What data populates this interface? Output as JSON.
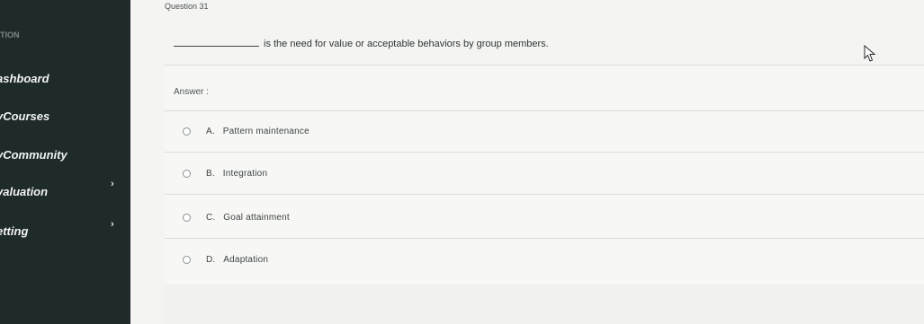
{
  "sidebar": {
    "brand": "TION",
    "items": [
      {
        "label": "ashboard",
        "has_chevron": false
      },
      {
        "label": "yCourses",
        "has_chevron": false
      },
      {
        "label": "yCommunity",
        "has_chevron": false
      },
      {
        "label": "valuation",
        "has_chevron": true
      },
      {
        "label": "etting",
        "has_chevron": true
      }
    ],
    "chevron_glyph": "›"
  },
  "question": {
    "number_label": "Question 31",
    "text": "is the need for value or acceptable behaviors by group members."
  },
  "answer": {
    "label": "Answer :",
    "options": [
      {
        "letter": "A.",
        "text": "Pattern maintenance"
      },
      {
        "letter": "B.",
        "text": "Integration"
      },
      {
        "letter": "C.",
        "text": "Goal attainment"
      },
      {
        "letter": "D.",
        "text": "Adaptation"
      }
    ]
  },
  "colors": {
    "sidebar_bg": "#1f2a2a",
    "main_bg": "#f4f5f3"
  },
  "icons": {
    "cursor": "mouse-pointer-icon"
  }
}
